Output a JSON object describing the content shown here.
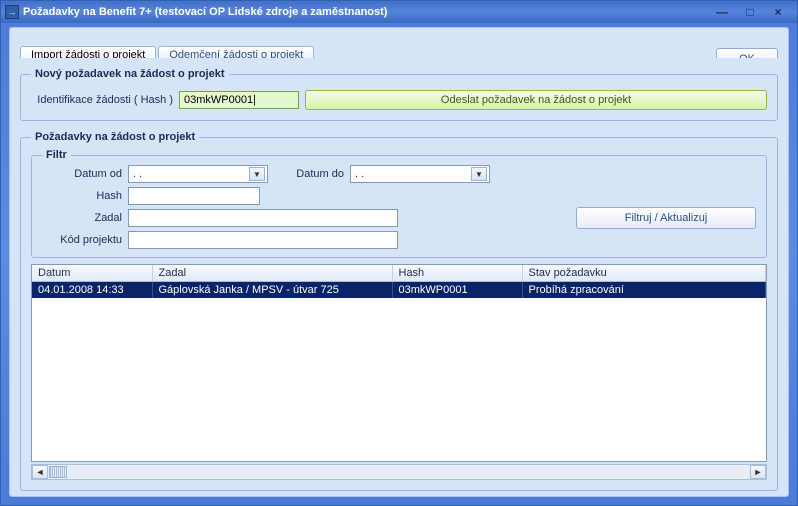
{
  "window": {
    "title": "Požadavky na Benefit 7+   (testovací OP Lidské zdroje a zaměstnanost)",
    "icon_glyph": "→"
  },
  "win_controls": {
    "minimize": "—",
    "maximize": "□",
    "close": "×"
  },
  "tabs": {
    "import": "Import žádosti o projekt",
    "odemceni": "Odemčení žádosti o projekt"
  },
  "ok_button": "OK",
  "new_request": {
    "legend": "Nový požadavek na žádost o projekt",
    "hash_label": "Identifikace žádosti ( Hash )",
    "hash_value": "03mkWP0001|",
    "send_label": "Odeslat požadavek na žádost o projekt"
  },
  "requests": {
    "legend": "Požadavky na žádost o projekt",
    "filter": {
      "legend": "Filtr",
      "date_from_label": "Datum od",
      "date_from_value": "  .  .",
      "date_to_label": "Datum do",
      "date_to_value": "  .  .",
      "hash_label": "Hash",
      "hash_value": "",
      "zadal_label": "Zadal",
      "zadal_value": "",
      "kod_label": "Kód projektu",
      "kod_value": "",
      "button": "Filtruj / Aktualizuj"
    },
    "table": {
      "headers": {
        "datum": "Datum",
        "zadal": "Zadal",
        "hash": "Hash",
        "stav": "Stav požadavku"
      },
      "rows": [
        {
          "datum": "04.01.2008 14:33",
          "zadal": "Gáplovská Janka  /  MPSV - útvar 725",
          "hash": "03mkWP0001",
          "stav": "Probíhá zpracování"
        }
      ]
    }
  }
}
